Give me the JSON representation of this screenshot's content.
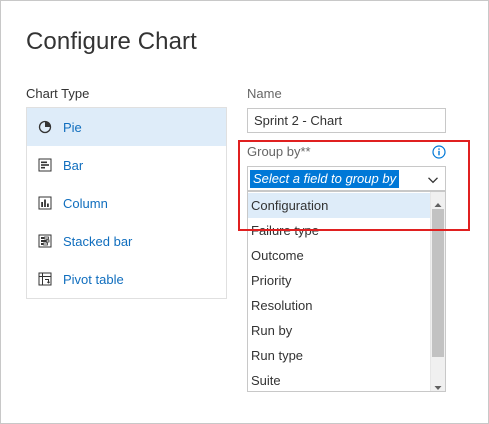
{
  "dialog": {
    "title": "Configure Chart"
  },
  "chart_type": {
    "label": "Chart Type",
    "items": [
      {
        "label": "Pie",
        "icon": "pie-icon",
        "selected": true
      },
      {
        "label": "Bar",
        "icon": "bar-icon",
        "selected": false
      },
      {
        "label": "Column",
        "icon": "column-icon",
        "selected": false
      },
      {
        "label": "Stacked bar",
        "icon": "stacked-bar-icon",
        "selected": false
      },
      {
        "label": "Pivot table",
        "icon": "pivot-table-icon",
        "selected": false
      }
    ]
  },
  "name": {
    "label": "Name",
    "value": "Sprint 2 - Chart"
  },
  "group_by": {
    "label": "Group by**",
    "placeholder": "Select a field to group by",
    "options": [
      "Configuration",
      "Failure type",
      "Outcome",
      "Priority",
      "Resolution",
      "Run by",
      "Run type",
      "Suite"
    ],
    "highlighted_option": "Configuration"
  },
  "colors": {
    "accent": "#0078d7",
    "link": "#106ebe",
    "selection": "#deecf9",
    "highlight_border": "#e02020"
  }
}
